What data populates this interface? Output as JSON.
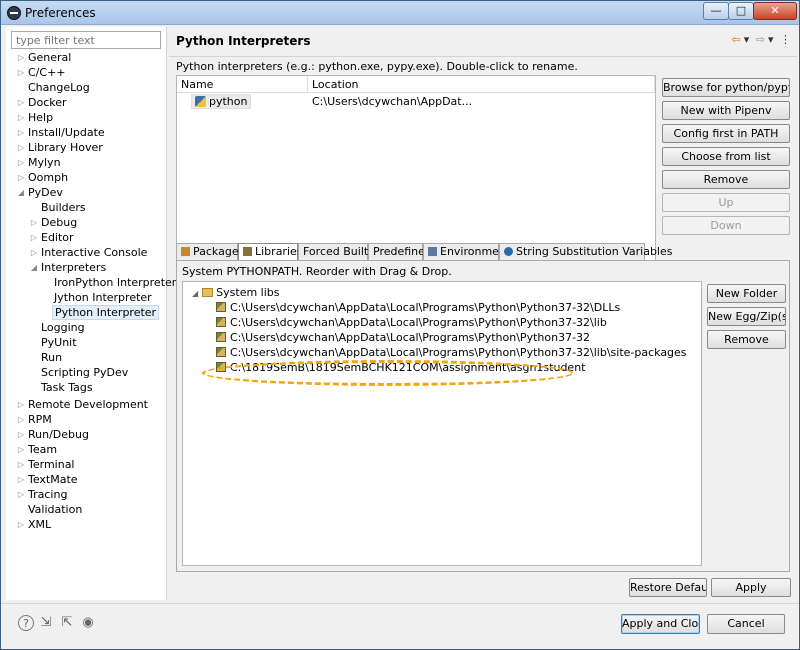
{
  "window": {
    "title": "Preferences"
  },
  "window_controls": {
    "minimize": "—",
    "maximize": "□",
    "close": "✕"
  },
  "filter": {
    "placeholder": "type filter text"
  },
  "tree": [
    {
      "label": "General",
      "arrow": "▷"
    },
    {
      "label": "C/C++",
      "arrow": "▷"
    },
    {
      "label": "ChangeLog",
      "arrow": ""
    },
    {
      "label": "Docker",
      "arrow": "▷"
    },
    {
      "label": "Help",
      "arrow": "▷"
    },
    {
      "label": "Install/Update",
      "arrow": "▷"
    },
    {
      "label": "Library Hover",
      "arrow": "▷"
    },
    {
      "label": "Mylyn",
      "arrow": "▷"
    },
    {
      "label": "Oomph",
      "arrow": "▷"
    },
    {
      "label": "PyDev",
      "arrow": "◢"
    },
    {
      "label": "Builders",
      "arrow": ""
    },
    {
      "label": "Debug",
      "arrow": "▷"
    },
    {
      "label": "Editor",
      "arrow": "▷"
    },
    {
      "label": "Interactive Console",
      "arrow": "▷"
    },
    {
      "label": "Interpreters",
      "arrow": "◢"
    },
    {
      "label": "IronPython Interpreter",
      "arrow": ""
    },
    {
      "label": "Jython Interpreter",
      "arrow": ""
    },
    {
      "label": "Python Interpreter",
      "arrow": ""
    },
    {
      "label": "Logging",
      "arrow": ""
    },
    {
      "label": "PyUnit",
      "arrow": ""
    },
    {
      "label": "Run",
      "arrow": ""
    },
    {
      "label": "Scripting PyDev",
      "arrow": ""
    },
    {
      "label": "Task Tags",
      "arrow": ""
    },
    {
      "label": "Remote Development",
      "arrow": "▷"
    },
    {
      "label": "RPM",
      "arrow": "▷"
    },
    {
      "label": "Run/Debug",
      "arrow": "▷"
    },
    {
      "label": "Team",
      "arrow": "▷"
    },
    {
      "label": "Terminal",
      "arrow": "▷"
    },
    {
      "label": "TextMate",
      "arrow": "▷"
    },
    {
      "label": "Tracing",
      "arrow": "▷"
    },
    {
      "label": "Validation",
      "arrow": ""
    },
    {
      "label": "XML",
      "arrow": "▷"
    }
  ],
  "page": {
    "title": "Python Interpreters",
    "description": "Python interpreters (e.g.: python.exe, pypy.exe).   Double-click to rename.",
    "nav": {
      "back": "⇦",
      "menu1": "▾",
      "forward": "⇨",
      "menu2": "▾",
      "more": "⋮"
    }
  },
  "interpreters_table": {
    "columns": [
      "Name",
      "Location"
    ],
    "rows": [
      {
        "name": "python",
        "location": "C:\\Users\\dcywchan\\AppDat..."
      }
    ]
  },
  "interpreter_buttons": {
    "browse": "Browse for python/pypy exe",
    "pipenv": "New with Pipenv",
    "config_path": "Config first in PATH",
    "choose": "Choose from list",
    "remove": "Remove",
    "up": "Up",
    "down": "Down"
  },
  "tabs": [
    "Packages",
    "Libraries",
    "Forced Builtins",
    "Predefined",
    "Environment",
    "String Substitution Variables"
  ],
  "libraries": {
    "description": "System PYTHONPATH.   Reorder with Drag & Drop.",
    "root": "System libs",
    "root_arrow": "◢",
    "items": [
      "C:\\Users\\dcywchan\\AppData\\Local\\Programs\\Python\\Python37-32\\DLLs",
      "C:\\Users\\dcywchan\\AppData\\Local\\Programs\\Python\\Python37-32\\lib",
      "C:\\Users\\dcywchan\\AppData\\Local\\Programs\\Python\\Python37-32",
      "C:\\Users\\dcywchan\\AppData\\Local\\Programs\\Python\\Python37-32\\lib\\site-packages",
      "C:\\1819SemB\\1819SemBCHK121COM\\assignment\\asgn1student"
    ]
  },
  "lib_buttons": {
    "new_folder": "New Folder",
    "new_egg": "New Egg/Zip(s)",
    "remove": "Remove"
  },
  "page_buttons": {
    "restore": "Restore Defaults",
    "apply": "Apply"
  },
  "dialog_buttons": {
    "apply_close": "Apply and Close",
    "cancel": "Cancel"
  },
  "footer_icons": {
    "help": "?",
    "import": "⇲",
    "export": "⇱",
    "record": "◉"
  },
  "colors": {
    "highlight_ellipse": "#f2a50c",
    "selection": "#e5eef9"
  }
}
